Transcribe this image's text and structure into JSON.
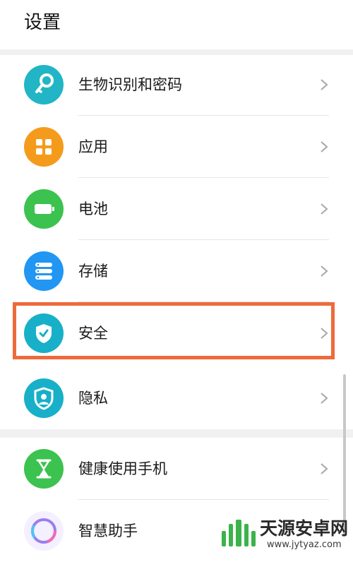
{
  "header": {
    "title": "设置"
  },
  "items": [
    {
      "label": "生物识别和密码",
      "icon": "key-icon",
      "color": "#21b5c5"
    },
    {
      "label": "应用",
      "icon": "apps-grid-icon",
      "color": "#f59b1c"
    },
    {
      "label": "电池",
      "icon": "battery-icon",
      "color": "#3cc24f"
    },
    {
      "label": "存储",
      "icon": "storage-icon",
      "color": "#2196f3"
    },
    {
      "label": "安全",
      "icon": "shield-check-icon",
      "color": "#17b0c8"
    },
    {
      "label": "隐私",
      "icon": "privacy-shield-icon",
      "color": "#17b0c8"
    },
    {
      "label": "健康使用手机",
      "icon": "hourglass-icon",
      "color": "#3cc24f"
    },
    {
      "label": "智慧助手",
      "icon": "assistant-ring-icon",
      "color": "#9b7ef0"
    }
  ],
  "highlighted_item": "安全",
  "highlight_color": "#ee6a3c",
  "watermark": {
    "name": "天源安卓网",
    "url": "www.jytyaz.com"
  }
}
